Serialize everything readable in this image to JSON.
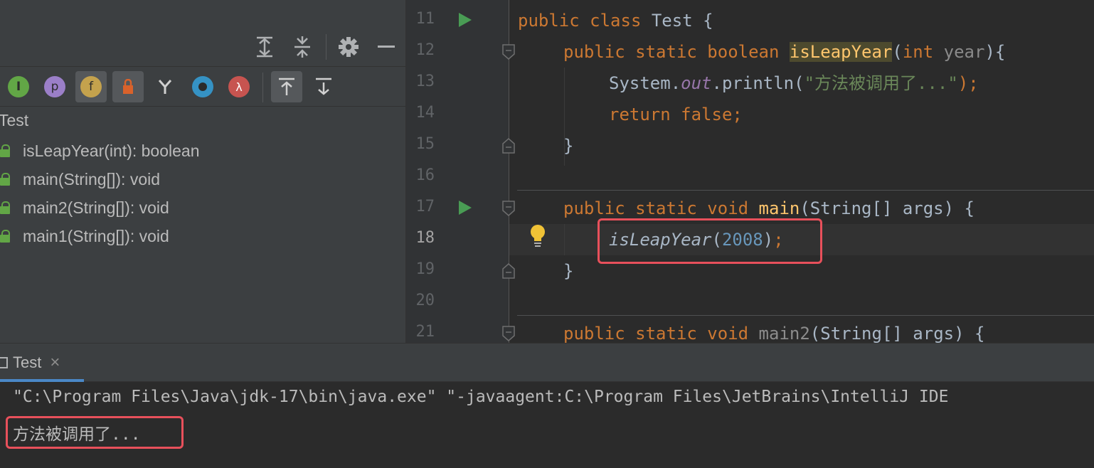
{
  "structure": {
    "root_label": "Test",
    "items": [
      {
        "label": "isLeapYear(int): boolean"
      },
      {
        "label": "main(String[]): void"
      },
      {
        "label": "main2(String[]): void"
      },
      {
        "label": "main1(String[]): void"
      }
    ],
    "filter_icons": [
      "I",
      "p",
      "f",
      "lock",
      "branch",
      "o",
      "λ"
    ]
  },
  "editor": {
    "line_numbers": [
      "11",
      "12",
      "13",
      "14",
      "15",
      "16",
      "17",
      "18",
      "19",
      "20",
      "21"
    ],
    "current_line": "18",
    "lines": {
      "l11": {
        "kw1": "public ",
        "kw2": "class ",
        "rest": "Test {"
      },
      "l12": {
        "kw": "public static boolean ",
        "name": "isLeapYear",
        "open": "(",
        "kw_int": "int ",
        "param": "year",
        "close": "){"
      },
      "l13": {
        "a": "System.",
        "field": "out",
        "b": ".println(",
        "str": "\"方法被调用了...\"",
        "c": ");"
      },
      "l14": {
        "kw": "return false",
        "semi": ";"
      },
      "l15": {
        "text": "}"
      },
      "l17": {
        "kw": "public static void ",
        "name": "main",
        "rest": "(String[] args) {"
      },
      "l18": {
        "call": "isLeapYear",
        "open": "(",
        "num": "2008",
        "close": ")",
        "semi": ";"
      },
      "l19": {
        "text": "}"
      },
      "l21": {
        "kw": "public static void ",
        "name": "main2",
        "rest": "(String[] args) {"
      }
    }
  },
  "run": {
    "tab_label": "Test",
    "close_symbol": "×",
    "command": "\"C:\\Program Files\\Java\\jdk-17\\bin\\java.exe\" \"-javaagent:C:\\Program Files\\JetBrains\\IntelliJ IDE",
    "output": "方法被调用了..."
  },
  "colors": {
    "highlight_box": "#e8505b",
    "run_icon": "#499c54",
    "keyword": "#cc7832",
    "method_decl": "#ffc66d",
    "string": "#6a8759",
    "number": "#6897bb"
  }
}
